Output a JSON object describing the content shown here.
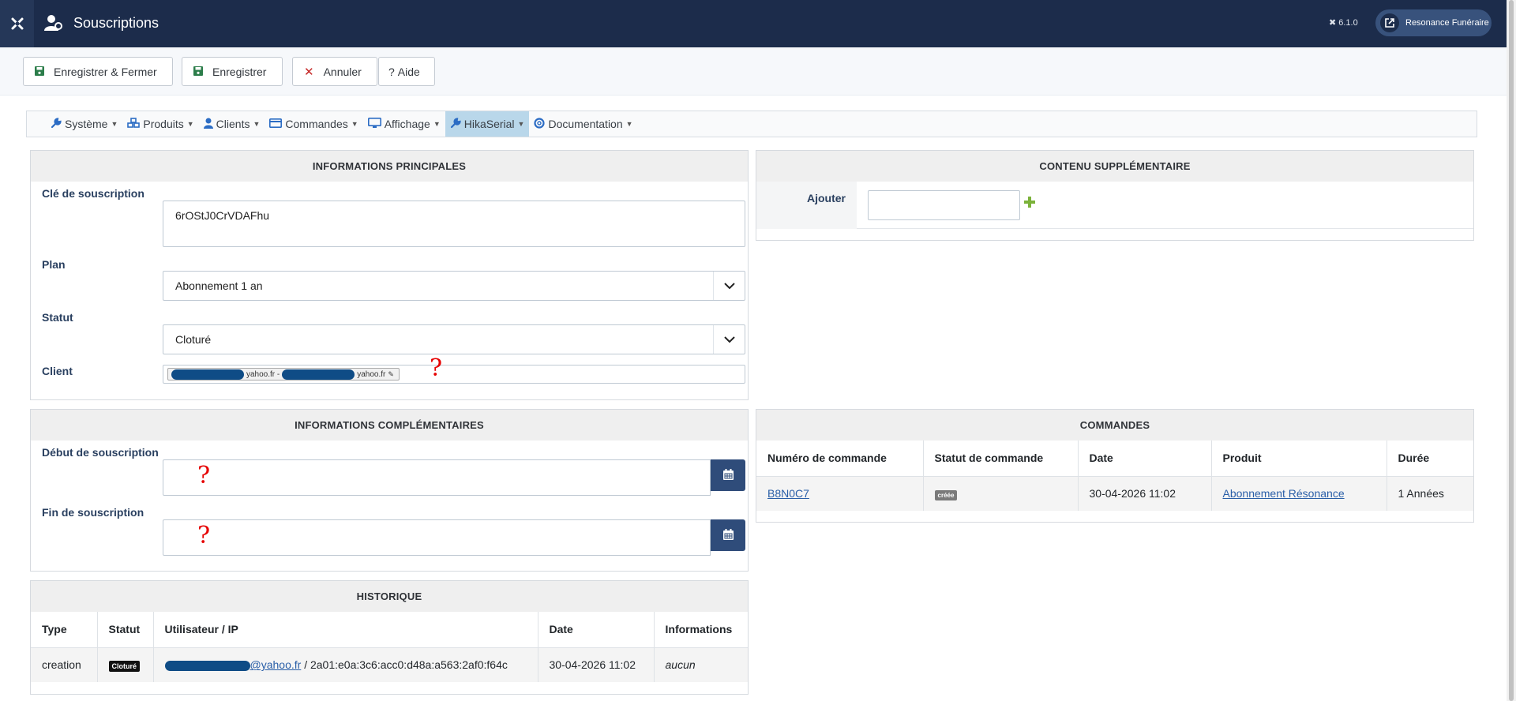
{
  "header": {
    "title": "Souscriptions",
    "version": "6.1.0",
    "site_button": "Resonance Funéraire",
    "logo_icon": "joomla-icon",
    "title_icon": "user-gear-icon"
  },
  "toolbar": {
    "save_close": "Enregistrer & Fermer",
    "save": "Enregistrer",
    "cancel": "Annuler",
    "help": "Aide"
  },
  "menu": {
    "items": [
      {
        "label": "Système",
        "icon": "wrench-icon"
      },
      {
        "label": "Produits",
        "icon": "cubes-icon"
      },
      {
        "label": "Clients",
        "icon": "user-icon"
      },
      {
        "label": "Commandes",
        "icon": "credit-card-icon"
      },
      {
        "label": "Affichage",
        "icon": "desktop-icon"
      },
      {
        "label": "HikaSerial",
        "icon": "key-icon",
        "active": true
      },
      {
        "label": "Documentation",
        "icon": "lifebuoy-icon"
      }
    ]
  },
  "main_info": {
    "title": "INFORMATIONS PRINCIPALES",
    "key_label": "Clé de souscription",
    "key_value": "6rOStJ0CrVDAFhu",
    "plan_label": "Plan",
    "plan_value": "Abonnement 1 an",
    "status_label": "Statut",
    "status_value": "Cloturé",
    "client_label": "Client",
    "client_part1": "yahoo.fr -",
    "client_part2": "yahoo.fr",
    "help_mark": "?"
  },
  "extra": {
    "title": "CONTENU SUPPLÉMENTAIRE",
    "add_label": "Ajouter"
  },
  "complementary": {
    "title": "INFORMATIONS COMPLÉMENTAIRES",
    "start_label": "Début de souscription",
    "end_label": "Fin de souscription",
    "help_mark": "?"
  },
  "orders": {
    "title": "COMMANDES",
    "columns": [
      "Numéro de commande",
      "Statut de commande",
      "Date",
      "Produit",
      "Durée"
    ],
    "rows": [
      {
        "number": "B8N0C7",
        "status": "créée",
        "date": "30-04-2026 11:02",
        "product": "Abonnement Résonance",
        "duration": "1 Années"
      }
    ]
  },
  "history": {
    "title": "HISTORIQUE",
    "columns": [
      "Type",
      "Statut",
      "Utilisateur / IP",
      "Date",
      "Informations"
    ],
    "rows": [
      {
        "type": "creation",
        "status": "Cloturé",
        "user_suffix": "@yahoo.fr",
        "ip": " / 2a01:e0a:3c6:acc0:d48a:a563:2af0:f64c",
        "date": "30-04-2026 11:02",
        "info": "aucun"
      }
    ]
  },
  "colors": {
    "header_bg": "#1c2c4b",
    "accent": "#2f4c7a",
    "menu_active": "#b9d7ea",
    "link": "#2a5fa8"
  }
}
